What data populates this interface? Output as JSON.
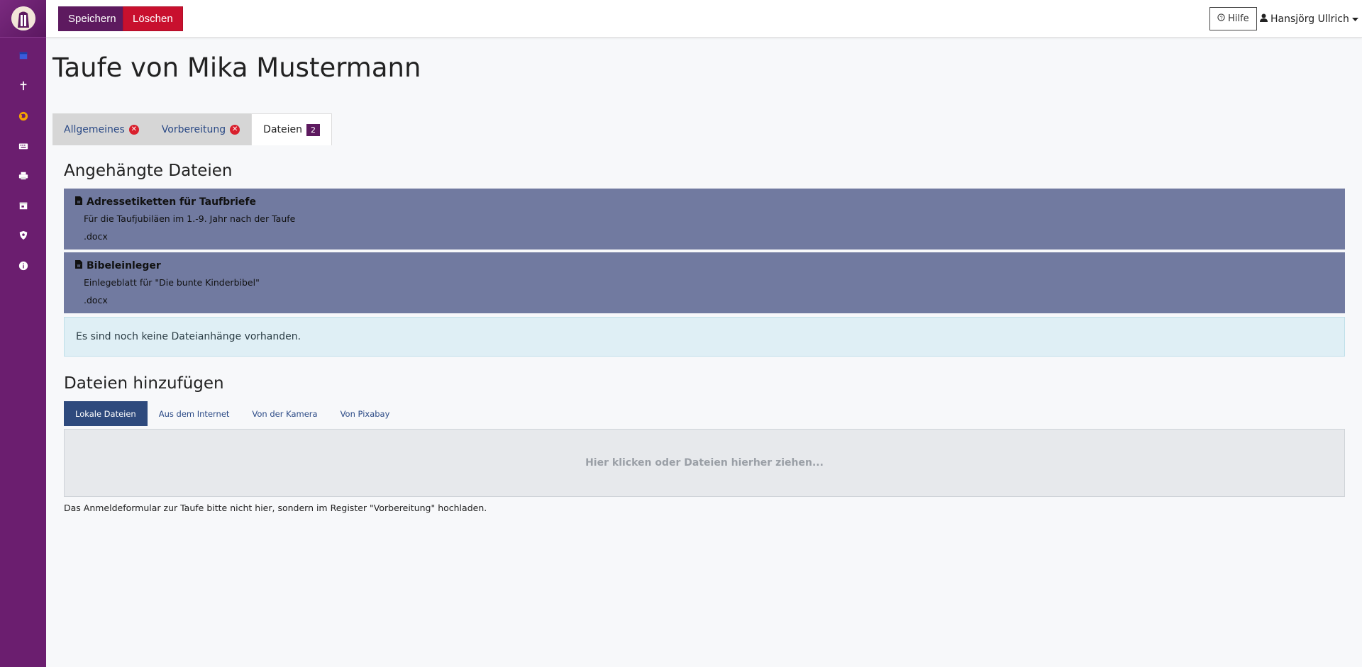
{
  "toolbar": {
    "save_label": "Speichern",
    "delete_label": "Löschen"
  },
  "header": {
    "help_label": "Hilfe",
    "user_name": "Hansjörg Ullrich"
  },
  "page": {
    "title": "Taufe von Mika Mustermann"
  },
  "tabs": [
    {
      "label": "Allgemeines",
      "error": "✕"
    },
    {
      "label": "Vorbereitung",
      "error": "✕"
    },
    {
      "label": "Dateien",
      "count": "2"
    }
  ],
  "attached": {
    "heading": "Angehängte Dateien",
    "files": [
      {
        "title": "Adressetiketten für Taufbriefe",
        "description": "Für die Taufjubiläen im 1.-9. Jahr nach der Taufe",
        "ext": ".docx"
      },
      {
        "title": "Bibeleinleger",
        "description": "Einlegeblatt für \"Die bunte Kinderbibel\"",
        "ext": ".docx"
      }
    ],
    "empty_notice": "Es sind noch keine Dateianhänge vorhanden."
  },
  "upload": {
    "heading": "Dateien hinzufügen",
    "tabs": [
      "Lokale Dateien",
      "Aus dem Internet",
      "Von der Kamera",
      "Von Pixabay"
    ],
    "dropzone_text": "Hier klicken oder Dateien hierher ziehen...",
    "hint": "Das Anmeldeformular zur Taufe bitte nicht hier, sondern im Register \"Vorbereitung\" hochladen."
  },
  "sidebar_icons": [
    "calendar-icon",
    "cross-icon",
    "globe-icon",
    "keyboard-icon",
    "printer-icon",
    "calendar-check-icon",
    "user-shield-icon",
    "info-icon"
  ],
  "colors": {
    "brand": "#6b1e6f",
    "save": "#5d1a5f",
    "delete": "#c8102e",
    "file_card": "#717aa0",
    "active_upload_tab": "#2e4a7d"
  }
}
